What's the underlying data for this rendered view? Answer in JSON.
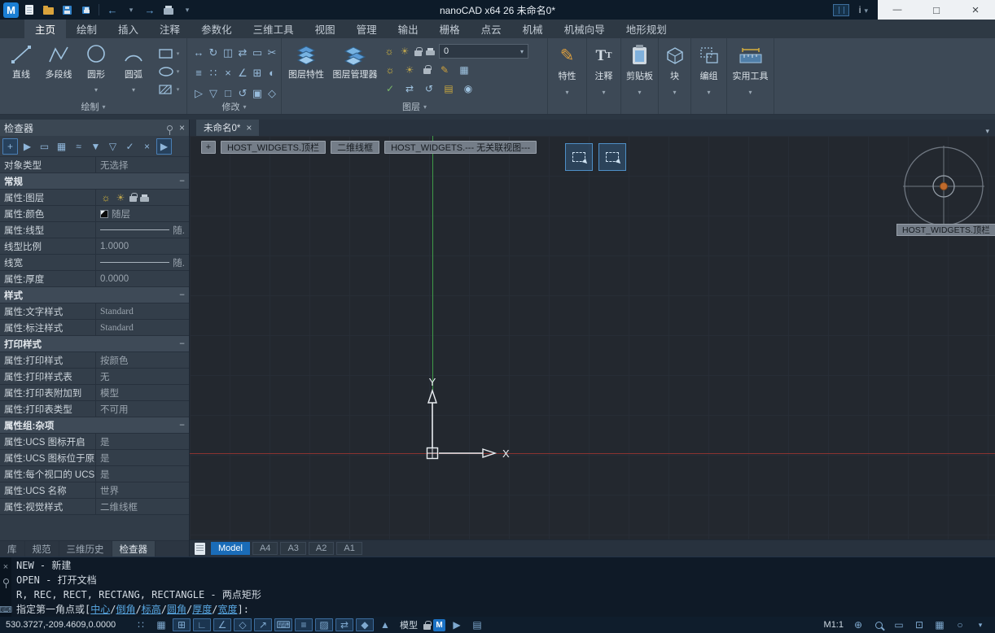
{
  "title_bar": {
    "title": "nanoCAD x64 26 未命名0*",
    "logo_letter": "M",
    "info_label": "i",
    "qat_icons": [
      "new-file-icon",
      "open-file-icon",
      "save-icon",
      "save-all-icon",
      "undo-icon",
      "redo-icon",
      "print-icon",
      "qat-dropdown-icon"
    ],
    "window_icons": [
      "minimize-icon",
      "maximize-icon",
      "close-icon"
    ]
  },
  "ribbon": {
    "tabs": [
      "主页",
      "绘制",
      "插入",
      "注释",
      "参数化",
      "三维工具",
      "视图",
      "管理",
      "输出",
      "栅格",
      "点云",
      "机械",
      "机械向导",
      "地形规划"
    ],
    "active_tab": "主页",
    "groups": {
      "draw": {
        "label": "绘制",
        "tools": [
          "直线",
          "多段线",
          "圆形",
          "圆弧"
        ]
      },
      "modify": {
        "label": "修改",
        "icons": [
          "move-icon",
          "rotate-icon",
          "mirror-icon",
          "offset-icon",
          "stretch-icon",
          "array-icon",
          "array-rect-icon",
          "trim-icon",
          "erase-icon",
          "chamfer-icon",
          "explode-icon",
          "break-icon",
          "scale-icon",
          "taper-icon",
          "rectangle-icon",
          "undo-mod-icon",
          "copy-icon",
          "fillet-icon"
        ]
      },
      "layers": {
        "label": "图层",
        "layer_properties": "图层特性",
        "layer_manager": "图层管理器",
        "current_layer": "0",
        "state_icons": [
          "layer-on-icon",
          "layer-freeze-icon",
          "layer-lock-icon",
          "layer-print-icon"
        ]
      },
      "properties": {
        "label": "特性"
      },
      "annotate": {
        "label": "注释"
      },
      "clipboard": {
        "label": "剪贴板"
      },
      "block": {
        "label": "块"
      },
      "group": {
        "label": "编组"
      },
      "utilities": {
        "label": "实用工具"
      }
    }
  },
  "inspector": {
    "title": "检查器",
    "toolbar_icons": [
      "select-add-icon",
      "pointer-icon",
      "window-select-icon",
      "crossing-select-icon",
      "fence-select-icon",
      "filter-icon",
      "quick-filter-icon",
      "apply-filter-icon",
      "clear-selection-icon",
      "pick-mode-icon"
    ],
    "rows": [
      {
        "label": "对象类型",
        "value": "无选择"
      },
      {
        "label": "常规",
        "type": "section"
      },
      {
        "label": "属性:图层",
        "type": "icons"
      },
      {
        "label": "属性:颜色",
        "value": "随层"
      },
      {
        "label": "属性:线型",
        "value": "随."
      },
      {
        "label": "线型比例",
        "value": "1.0000"
      },
      {
        "label": "线宽",
        "value": "随."
      },
      {
        "label": "属性:厚度",
        "value": "0.0000"
      },
      {
        "label": "样式",
        "type": "section"
      },
      {
        "label": "属性:文字样式",
        "value": "Standard"
      },
      {
        "label": "属性:标注样式",
        "value": "Standard"
      },
      {
        "label": "打印样式",
        "type": "section"
      },
      {
        "label": "属性:打印样式",
        "value": "按颜色"
      },
      {
        "label": "属性:打印样式表",
        "value": "无"
      },
      {
        "label": "属性:打印表附加到",
        "value": "模型"
      },
      {
        "label": "属性:打印表类型",
        "value": "不可用"
      },
      {
        "label": "属性组:杂项",
        "type": "section"
      },
      {
        "label": "属性:UCS 图标开启",
        "value": "是"
      },
      {
        "label": "属性:UCS 图标位于原点",
        "value": "是"
      },
      {
        "label": "属性:每个视口的 UCS",
        "value": "是"
      },
      {
        "label": "属性:UCS 名称",
        "value": "世界"
      },
      {
        "label": "属性:视觉样式",
        "value": "二维线框"
      }
    ],
    "bottom_tabs": [
      "库",
      "规范",
      "三维历史",
      "检查器"
    ],
    "active_bottom_tab": "检查器"
  },
  "document": {
    "tab_label": "未命名0*"
  },
  "canvas": {
    "viewport_buttons": [
      "+",
      "HOST_WIDGETS.顶栏",
      "二维线框",
      "HOST_WIDGETS.--- 无关联视图---"
    ],
    "selection_mode_icons": [
      "window-selection-icon",
      "crossing-selection-icon"
    ],
    "nav_wheel_label": "HOST_WIDGETS.顶栏",
    "ucs": {
      "x": "X",
      "y": "Y"
    }
  },
  "layout_tabs": {
    "tabs": [
      "Model",
      "A4",
      "A3",
      "A2",
      "A1"
    ],
    "active": "Model"
  },
  "command": {
    "lines": [
      "NEW - 新建",
      "OPEN - 打开文档",
      "R, REC, RECT, RECTANG, RECTANGLE - 两点矩形"
    ],
    "prompt_prefix": "指定第一角点或[",
    "prompt_options": [
      "中心",
      "倒角",
      "标高",
      "圆角",
      "厚度",
      "宽度"
    ],
    "prompt_separator": "/",
    "prompt_suffix": "]:",
    "gutter_icons": [
      "close-icon",
      "pin-icon",
      "keyboard-icon"
    ]
  },
  "status_bar": {
    "coordinates": "530.3727,-209.4609,0.0000",
    "model_label": "模型",
    "monitor_label": "M",
    "scale_label": "M1:1",
    "left_icons": [
      "grid-display-icon",
      "snap-grid-icon",
      "snap-mode-icon",
      "ortho-mode-icon",
      "polar-tracking-icon",
      "object-snap-icon",
      "object-snap-tracking-icon",
      "dynamic-input-icon",
      "lineweight-display-icon",
      "transparency-icon",
      "selection-cycling-icon",
      "3d-object-snap-icon",
      "annotation-visibility-icon"
    ],
    "right_icons": [
      "pan-icon",
      "zoom-icon",
      "zoom-window-icon",
      "zoom-extents-icon",
      "viewports-icon",
      "navigation-circle-icon",
      "status-menu-icon"
    ]
  },
  "colors": {
    "accent": "#1a6cb8",
    "titlebar": "#0d1b29",
    "ribbon": "#3d4956",
    "canvas": "#23282f",
    "axis_x": "#8a3331",
    "axis_y": "#3f9b48",
    "ucs_icon": "#e9edf1",
    "selection_highlight": "#4e8fc7",
    "nav_center": "#c06a2c"
  }
}
